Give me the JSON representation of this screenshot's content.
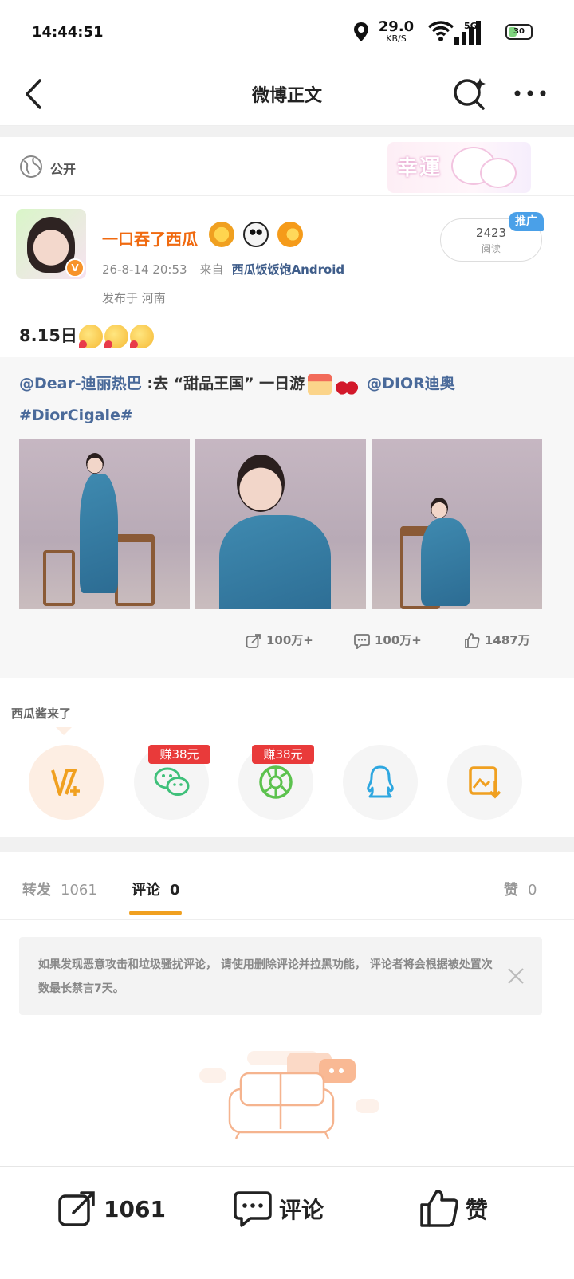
{
  "status_bar": {
    "time": "14:44:51",
    "speed_value": "29.0",
    "speed_unit": "KB/S",
    "network": "5G",
    "battery": "30"
  },
  "nav": {
    "title": "微博正文",
    "back_icon": "chevron-left-icon",
    "search_icon": "search-sparkle-icon",
    "more_icon": "more-dots-icon"
  },
  "visibility": {
    "label": "公开",
    "icon": "globe-icon",
    "sticker_text": "幸運"
  },
  "author": {
    "name": "一口吞了西瓜",
    "verified_badge": "V",
    "time": "26-8-14 20:53",
    "from_label": "来自",
    "source": "西瓜饭饭饱Android",
    "location": "发布于 河南",
    "read_count": "2423",
    "read_label": "阅读",
    "promo_label": "推广"
  },
  "post": {
    "text": "8.15日"
  },
  "repost": {
    "mention1": "@Dear-迪丽热巴",
    "body": " :去 “甜品王国” 一日游",
    "mention2": "@DIOR迪奥",
    "hashtag": "#DiorCigale#",
    "stats": {
      "reposts": "100万+",
      "comments": "100万+",
      "likes": "1487万"
    }
  },
  "share": {
    "label": "西瓜酱来了",
    "earn_badge_1": "赚38元",
    "earn_badge_2": "赚38元",
    "targets": [
      "weibo-vplus",
      "wechat",
      "moments",
      "qq",
      "save-image"
    ]
  },
  "tabs": {
    "repost_label": "转发",
    "repost_count": "1061",
    "comment_label": "评论",
    "comment_count": "0",
    "like_label": "赞",
    "like_count": "0"
  },
  "notice": {
    "text": "如果发现恶意攻击和垃圾骚扰评论， 请使用删除评论并拉黑功能， 评论者将会根据被处置次数最长禁言7天。"
  },
  "bottom_bar": {
    "repost_count": "1061",
    "comment_label": "评论",
    "like_label": "赞"
  },
  "colors": {
    "accent_orange": "#f0a020",
    "username_orange": "#f06a10",
    "link_blue": "#4a6a9a",
    "earn_red": "#e93a3a",
    "wechat_green": "#3fc07a",
    "qq_blue": "#2ea7e0"
  }
}
